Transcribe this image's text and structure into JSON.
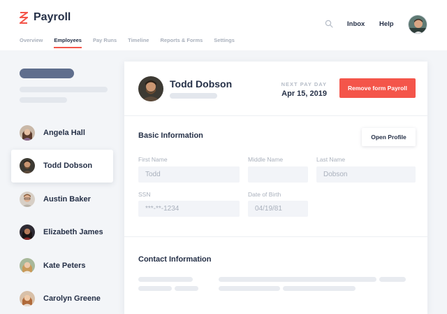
{
  "app": {
    "name": "Payroll",
    "brand_color": "#f4554a"
  },
  "nav": {
    "items": [
      {
        "label": "Overview",
        "active": false
      },
      {
        "label": "Employees",
        "active": true
      },
      {
        "label": "Pay Runs",
        "active": false
      },
      {
        "label": "Timeline",
        "active": false
      },
      {
        "label": "Reports & Forms",
        "active": false
      },
      {
        "label": "Settings",
        "active": false
      }
    ]
  },
  "header": {
    "inbox_label": "Inbox",
    "help_label": "Help",
    "search_icon": "search-icon"
  },
  "employees": [
    {
      "name": "Angela Hall",
      "active": false
    },
    {
      "name": "Todd Dobson",
      "active": true
    },
    {
      "name": "Austin Baker",
      "active": false
    },
    {
      "name": "Elizabeth James",
      "active": false
    },
    {
      "name": "Kate Peters",
      "active": false
    },
    {
      "name": "Carolyn Greene",
      "active": false
    }
  ],
  "profile": {
    "name": "Todd Dobson",
    "next_pay_label": "NEXT PAY DAY",
    "next_pay_date": "Apr 15, 2019",
    "remove_label": "Remove form Payroll"
  },
  "basic_info": {
    "title": "Basic Information",
    "open_profile_label": "Open Profile",
    "first_name_label": "First Name",
    "first_name_value": "Todd",
    "middle_name_label": "Middle Name",
    "middle_name_value": "",
    "last_name_label": "Last Name",
    "last_name_value": "Dobson",
    "ssn_label": "SSN",
    "ssn_value": "***-**-1234",
    "dob_label": "Date of Birth",
    "dob_value": "04/19/81"
  },
  "contact_info": {
    "title": "Contact Information"
  }
}
